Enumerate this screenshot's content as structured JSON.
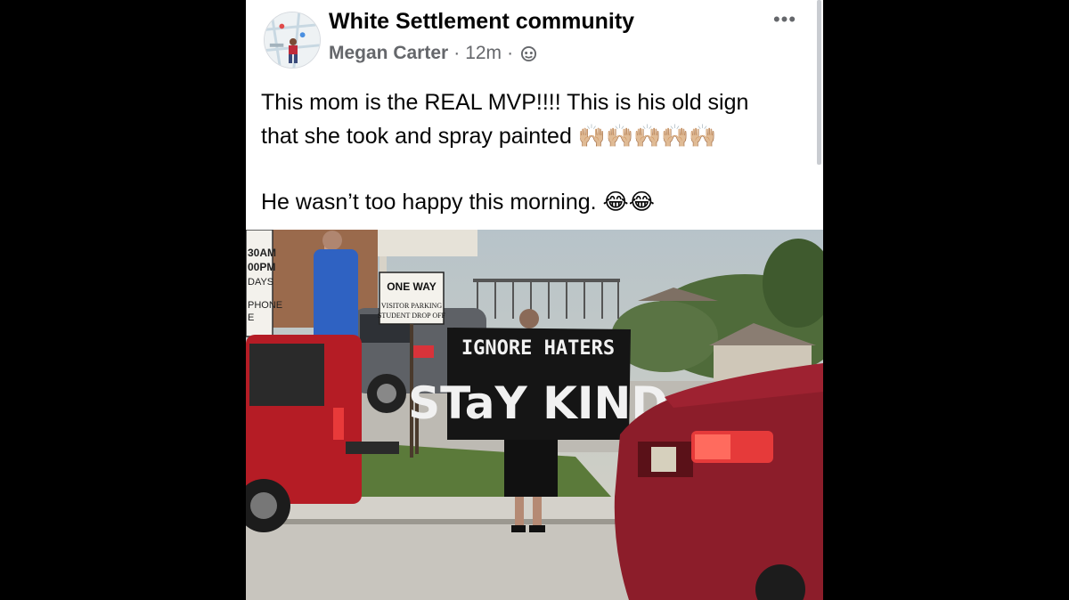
{
  "post": {
    "group_name": "White Settlement community",
    "author": "Megan Carter",
    "separator": "·",
    "time": "12m",
    "audience_icon": "public-globe-icon",
    "more_icon": "more-options-icon",
    "more_label": "•••",
    "text_line1": "This mom is the REAL MVP!!!! This is his old sign",
    "text_line2": "that she took and spray painted",
    "text_line2_emoji": "🙌🏼🙌🏼🙌🏼🙌🏼🙌🏼",
    "text_line3": "He wasn’t too happy this morning.",
    "text_line3_emoji": "😂😂"
  },
  "photo": {
    "banner_line1": "IGNORE HATERS",
    "banner_line2": "STaY KIND",
    "one_way_sign": "ONE WAY",
    "parking_sign_line1": "VISITOR PARKING",
    "parking_sign_line2": "STUDENT DROP OFF",
    "left_sign_line1": "30AM",
    "left_sign_line2": "00PM",
    "left_sign_line3": "DAYS",
    "left_sign_line4": "PHONE",
    "left_sign_line5": "E"
  },
  "colors": {
    "background": "#000000",
    "card": "#ffffff",
    "primary_text": "#050505",
    "secondary_text": "#65676b"
  }
}
